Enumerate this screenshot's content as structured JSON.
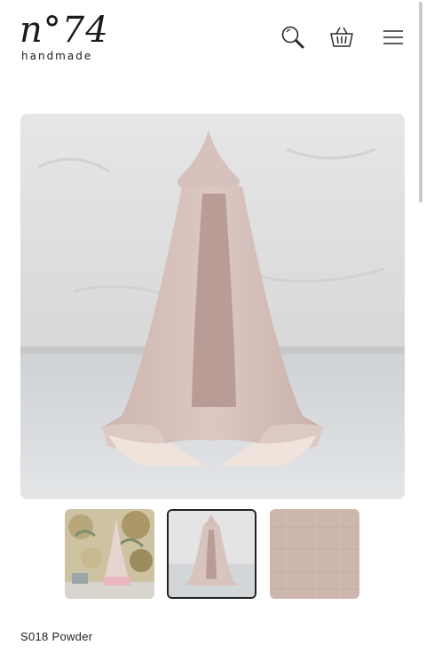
{
  "brand": {
    "logo_mark": "n°74",
    "logo_sub": "handmade"
  },
  "header": {
    "icons": [
      "search-icon",
      "basket-icon",
      "menu-icon"
    ]
  },
  "gallery": {
    "main_image": "powder-canopy-photo",
    "thumbnails": [
      "floral-room-thumbnail",
      "canopy-thumbnail",
      "fabric-swatch-thumbnail"
    ],
    "active_thumbnail": 1
  },
  "product": {
    "title": "S018 Powder"
  },
  "colors": {
    "canopy": "#d6c1bc",
    "canopy_shadow": "#b99c96",
    "swatch": "#cdb7ac"
  }
}
